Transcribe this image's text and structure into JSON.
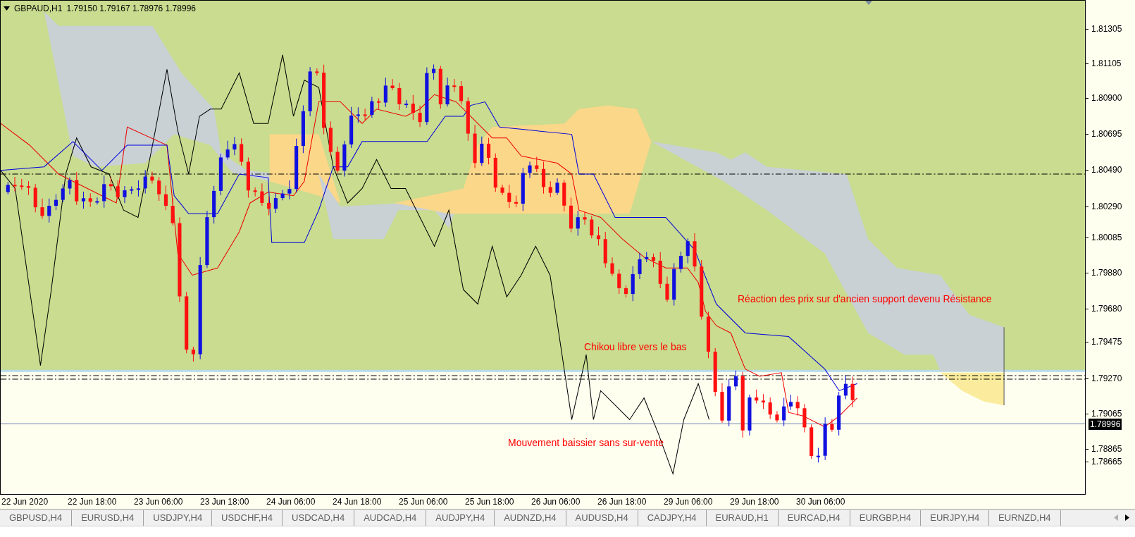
{
  "chart": {
    "symbol": "GBPAUD,H1",
    "quotes": "1.79150 1.79167 1.78976 1.78996",
    "annotations": [
      "Réaction des prix sur d'ancien support devenu Résistance",
      "Chikou libre vers le bas",
      "Mouvement baissier sans sur-vente"
    ],
    "price_axis": [
      "1.81305",
      "1.81105",
      "1.80900",
      "1.80695",
      "1.80490",
      "1.80290",
      "1.80085",
      "1.79880",
      "1.79680",
      "1.79475",
      "1.79270",
      "1.79065",
      "1.78865",
      "1.78665"
    ],
    "current_price": "1.78996",
    "time_axis": [
      "22 Jun 2020",
      "22 Jun 18:00",
      "23 Jun 06:00",
      "23 Jun 18:00",
      "24 Jun 06:00",
      "24 Jun 18:00",
      "25 Jun 06:00",
      "25 Jun 18:00",
      "26 Jun 06:00",
      "26 Jun 18:00",
      "29 Jun 06:00",
      "29 Jun 18:00",
      "30 Jun 06:00"
    ]
  },
  "tabs": [
    {
      "label": "GBPUSD,H4",
      "selected": false
    },
    {
      "label": "EURUSD,H4",
      "selected": false
    },
    {
      "label": "USDJPY,H4",
      "selected": false
    },
    {
      "label": "USDCHF,H4",
      "selected": false
    },
    {
      "label": "USDCAD,H4",
      "selected": false
    },
    {
      "label": "AUDCAD,H4",
      "selected": false
    },
    {
      "label": "AUDJPY,H4",
      "selected": false
    },
    {
      "label": "AUDNZD,H4",
      "selected": false
    },
    {
      "label": "AUDUSD,H4",
      "selected": false
    },
    {
      "label": "CADJPY,H4",
      "selected": false
    },
    {
      "label": "EURAUD,H1",
      "selected": false
    },
    {
      "label": "EURCAD,H4",
      "selected": false
    },
    {
      "label": "EURGBP,H4",
      "selected": false
    },
    {
      "label": "EURJPY,H4",
      "selected": false
    },
    {
      "label": "EURNZD,H4",
      "selected": false
    }
  ]
}
